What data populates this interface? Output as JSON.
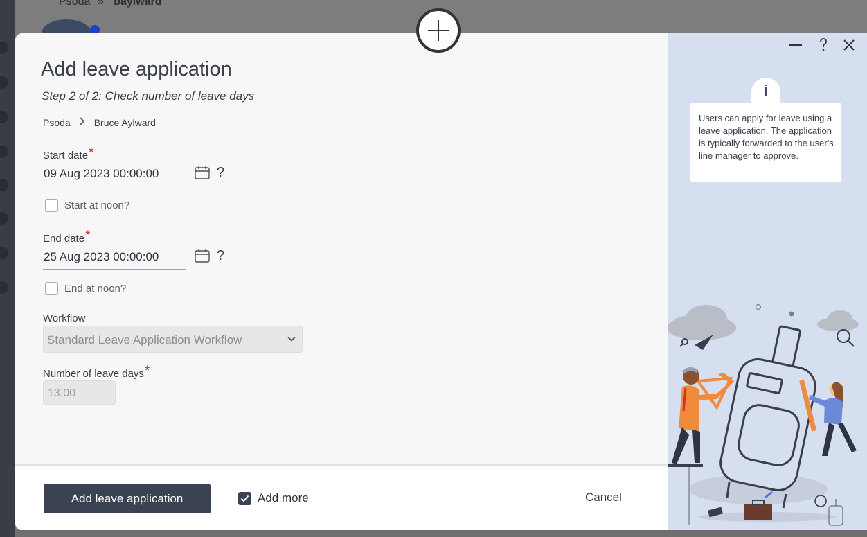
{
  "background": {
    "breadcrumb_org": "Psoda",
    "breadcrumb_sep": "»",
    "breadcrumb_user": "baylward"
  },
  "modal": {
    "title": "Add leave application",
    "subtitle": "Step 2 of 2: Check number of leave days",
    "breadcrumb": [
      "Psoda",
      "Bruce Aylward"
    ],
    "breadcrumb_separator": ">",
    "start_date": {
      "label": "Start date",
      "value": "09 Aug 2023 00:00:00",
      "help": "?",
      "noon_label": "Start at noon?",
      "noon_checked": false
    },
    "end_date": {
      "label": "End date",
      "value": "25 Aug 2023 00:00:00",
      "help": "?",
      "noon_label": "End at noon?",
      "noon_checked": false
    },
    "required_mark": "*",
    "workflow": {
      "label": "Workflow",
      "selected": "Standard Leave Application Workflow"
    },
    "leave_days": {
      "label": "Number of leave days",
      "value": "13.00"
    }
  },
  "footer": {
    "submit_label": "Add leave application",
    "add_more_label": "Add more",
    "add_more_checked": true,
    "cancel_label": "Cancel"
  },
  "help_panel": {
    "info_glyph": "i",
    "text": "Users can apply for leave using a leave application. The application is typically forwarded to the user's line manager to approve."
  },
  "icons": {
    "plus": "plus-icon",
    "calendar": "calendar-icon",
    "minimize": "minimize-icon",
    "help": "question-icon",
    "close": "close-icon",
    "chevron": "chevron-down-icon"
  },
  "colors": {
    "primary": "#3b4252",
    "required": "#d0302f",
    "panel_bg": "#d6dff0",
    "modal_bg": "#f7f7f7"
  }
}
